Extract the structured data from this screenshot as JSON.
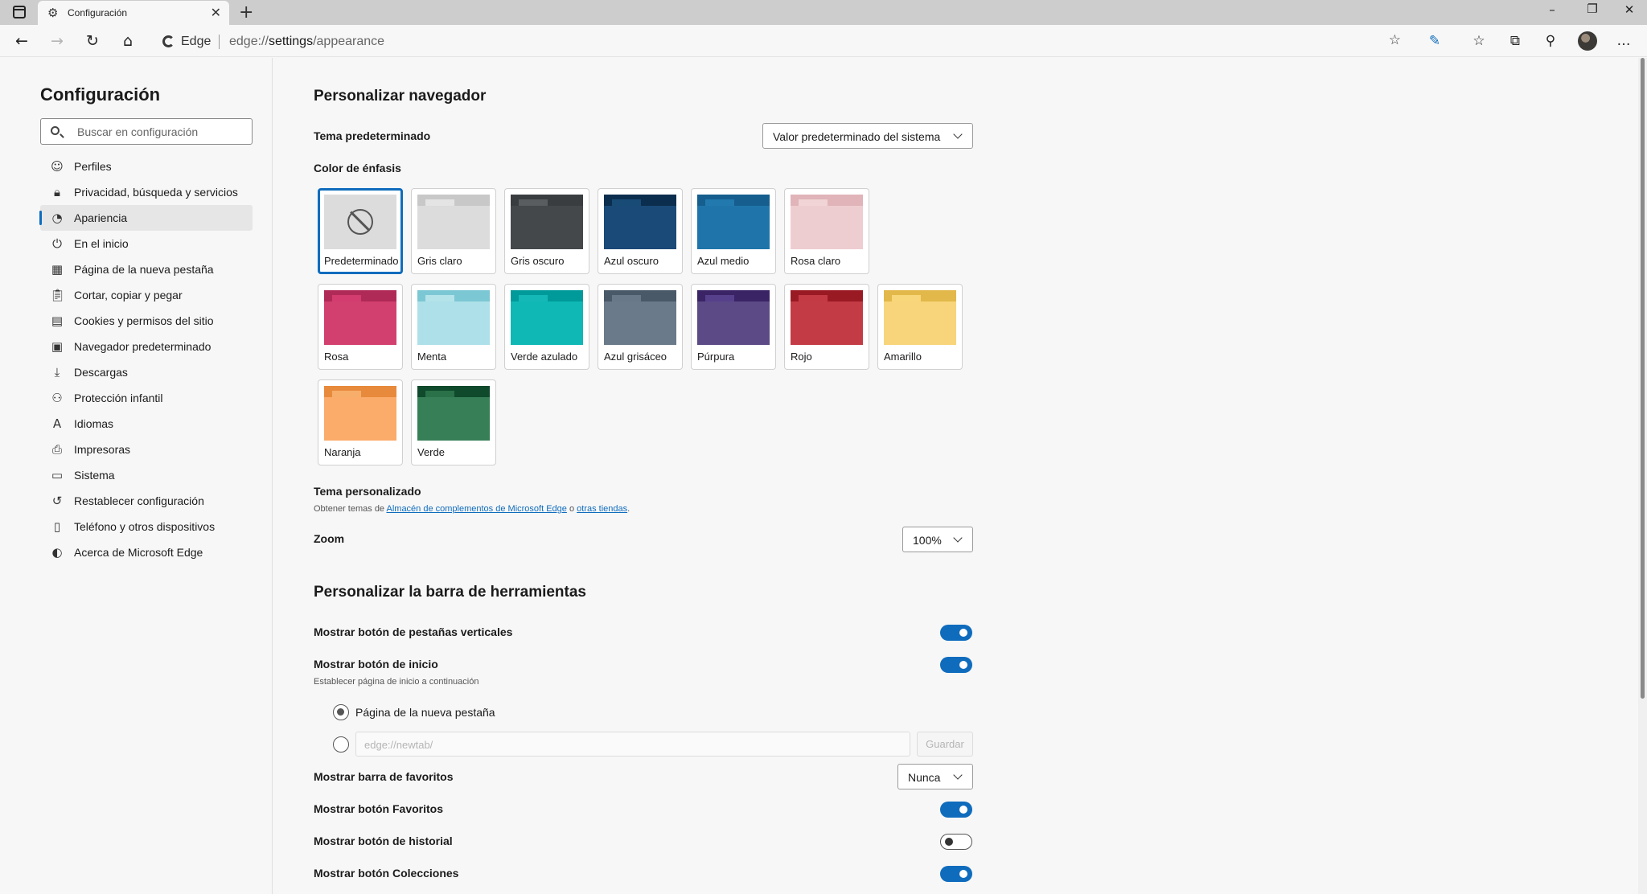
{
  "tab": {
    "title": "Configuración"
  },
  "address": {
    "brand": "Edge",
    "url_prefix": "edge://",
    "url_host": "settings",
    "url_path": "/appearance"
  },
  "sidebar": {
    "title": "Configuración",
    "search_placeholder": "Buscar en configuración",
    "items": [
      {
        "label": "Perfiles",
        "icon": "profile-icon",
        "glyph": "☺"
      },
      {
        "label": "Privacidad, búsqueda y servicios",
        "icon": "lock-icon",
        "glyph": "🔒︎"
      },
      {
        "label": "Apariencia",
        "icon": "palette-icon",
        "glyph": "◔"
      },
      {
        "label": "En el inicio",
        "icon": "power-icon",
        "glyph": "⏻"
      },
      {
        "label": "Página de la nueva pestaña",
        "icon": "new-tab-page-icon",
        "glyph": "▦"
      },
      {
        "label": "Cortar, copiar y pegar",
        "icon": "clipboard-icon",
        "glyph": "📋︎"
      },
      {
        "label": "Cookies y permisos del sitio",
        "icon": "site-permissions-icon",
        "glyph": "▤"
      },
      {
        "label": "Navegador predeterminado",
        "icon": "default-browser-icon",
        "glyph": "▣"
      },
      {
        "label": "Descargas",
        "icon": "download-icon",
        "glyph": "⤓"
      },
      {
        "label": "Protección infantil",
        "icon": "family-icon",
        "glyph": "⚇"
      },
      {
        "label": "Idiomas",
        "icon": "language-icon",
        "glyph": "A"
      },
      {
        "label": "Impresoras",
        "icon": "printer-icon",
        "glyph": "⎙"
      },
      {
        "label": "Sistema",
        "icon": "system-icon",
        "glyph": "▭"
      },
      {
        "label": "Restablecer configuración",
        "icon": "reset-icon",
        "glyph": "↺"
      },
      {
        "label": "Teléfono y otros dispositivos",
        "icon": "phone-icon",
        "glyph": "▯"
      },
      {
        "label": "Acerca de Microsoft Edge",
        "icon": "edge-logo-icon",
        "glyph": "◐"
      }
    ],
    "active_index": 2
  },
  "main": {
    "section1_title": "Personalizar navegador",
    "theme_label": "Tema predeterminado",
    "theme_value": "Valor predeterminado del sistema",
    "accent_label": "Color de énfasis",
    "accents": [
      {
        "label": "Predeterminado",
        "selected": true,
        "top": "#dcdcdc",
        "tab": "#dcdcdc",
        "body": "#dcdcdc"
      },
      {
        "label": "Gris claro",
        "top": "#c8c8c8",
        "tab": "#e4e4e4",
        "body": "#dcdcdc"
      },
      {
        "label": "Gris oscuro",
        "top": "#3a3d40",
        "tab": "#5a5d60",
        "body": "#45484b"
      },
      {
        "label": "Azul oscuro",
        "top": "#0c2e4e",
        "tab": "#194b77",
        "body": "#1a4a78"
      },
      {
        "label": "Azul medio",
        "top": "#155e8e",
        "tab": "#2279ad",
        "body": "#1f75aa"
      },
      {
        "label": "Rosa claro",
        "top": "#e0b4b8",
        "tab": "#f0d4d6",
        "body": "#eecdd0"
      },
      {
        "label": "Rosa",
        "top": "#b02a58",
        "tab": "#d23c6e",
        "body": "#d2406f"
      },
      {
        "label": "Menta",
        "top": "#7cc7d4",
        "tab": "#b4e3ea",
        "body": "#ade0e8"
      },
      {
        "label": "Verde azulado",
        "top": "#009a9a",
        "tab": "#14b8b6",
        "body": "#0fb8b5"
      },
      {
        "label": "Azul grisáceo",
        "top": "#4a5968",
        "tab": "#687888",
        "body": "#6a7a8b"
      },
      {
        "label": "Púrpura",
        "top": "#3a2466",
        "tab": "#56408c",
        "body": "#5c4a86"
      },
      {
        "label": "Rojo",
        "top": "#9a1a24",
        "tab": "#c43a44",
        "body": "#c33b45"
      },
      {
        "label": "Amarillo",
        "top": "#e3b84a",
        "tab": "#f8d67a",
        "body": "#f8d57a"
      },
      {
        "label": "Naranja",
        "top": "#e88a3c",
        "tab": "#f7ae6a",
        "body": "#fbab6a"
      },
      {
        "label": "Verde",
        "top": "#0f4a2c",
        "tab": "#2a7048",
        "body": "#367f57"
      }
    ],
    "custom_theme_label": "Tema personalizado",
    "custom_theme_text_1": "Obtener temas de ",
    "custom_theme_link_1": "Almacén de complementos de Microsoft Edge",
    "custom_theme_text_2": " o ",
    "custom_theme_link_2": "otras tiendas",
    "custom_theme_text_3": ".",
    "zoom_label": "Zoom",
    "zoom_value": "100%",
    "section2_title": "Personalizar la barra de herramientas",
    "vertical_tabs_label": "Mostrar botón de pestañas verticales",
    "vertical_tabs_on": true,
    "home_button_label": "Mostrar botón de inicio",
    "home_button_on": true,
    "home_sub": "Establecer página de inicio a continuación",
    "radio_new_tab_label": "Página de la nueva pestaña",
    "url_placeholder": "edge://newtab/",
    "save_label": "Guardar",
    "favorites_bar_label": "Mostrar barra de favoritos",
    "favorites_bar_value": "Nunca",
    "favorites_button_label": "Mostrar botón Favoritos",
    "favorites_button_on": true,
    "history_button_label": "Mostrar botón de historial",
    "history_button_on": false,
    "collections_button_label": "Mostrar botón Colecciones",
    "collections_button_on": true
  },
  "colors": {
    "accent": "#0f6cbd",
    "link": "#0f6cbd"
  }
}
